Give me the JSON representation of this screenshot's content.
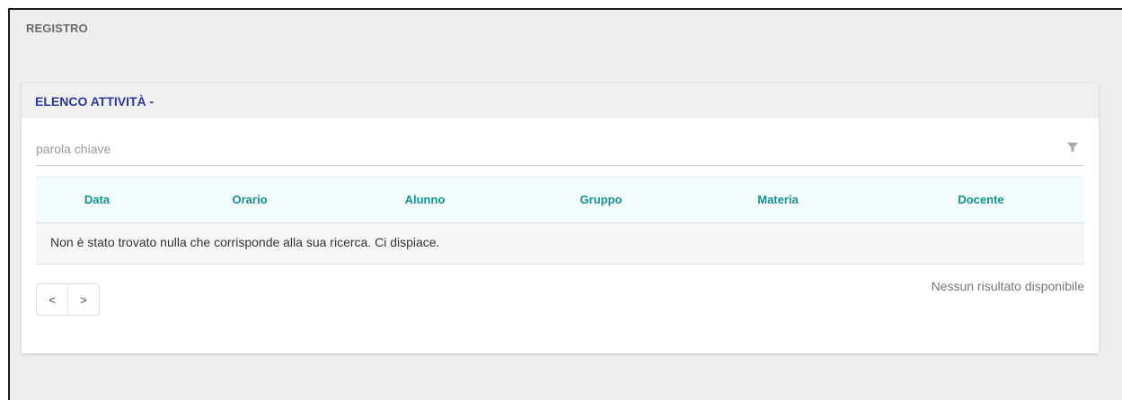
{
  "page": {
    "heading": "REGISTRO"
  },
  "card": {
    "title": "ELENCO ATTIVITÀ -"
  },
  "search": {
    "placeholder": "parola chiave",
    "value": "",
    "filter_icon": "filter-icon"
  },
  "table": {
    "columns": [
      "Data",
      "Orario",
      "Alunno",
      "Gruppo",
      "Materia",
      "Docente"
    ],
    "empty_message": "Non è stato trovato nulla che corrisponde alla sua ricerca. Ci dispiace."
  },
  "pagination": {
    "prev_label": "<",
    "next_label": ">",
    "status": "Nessun risultato disponibile"
  },
  "colors": {
    "title": "#2b3990",
    "column_header": "#14918f",
    "table_header_bg": "#f3fcfd",
    "background": "#eeeeee"
  }
}
